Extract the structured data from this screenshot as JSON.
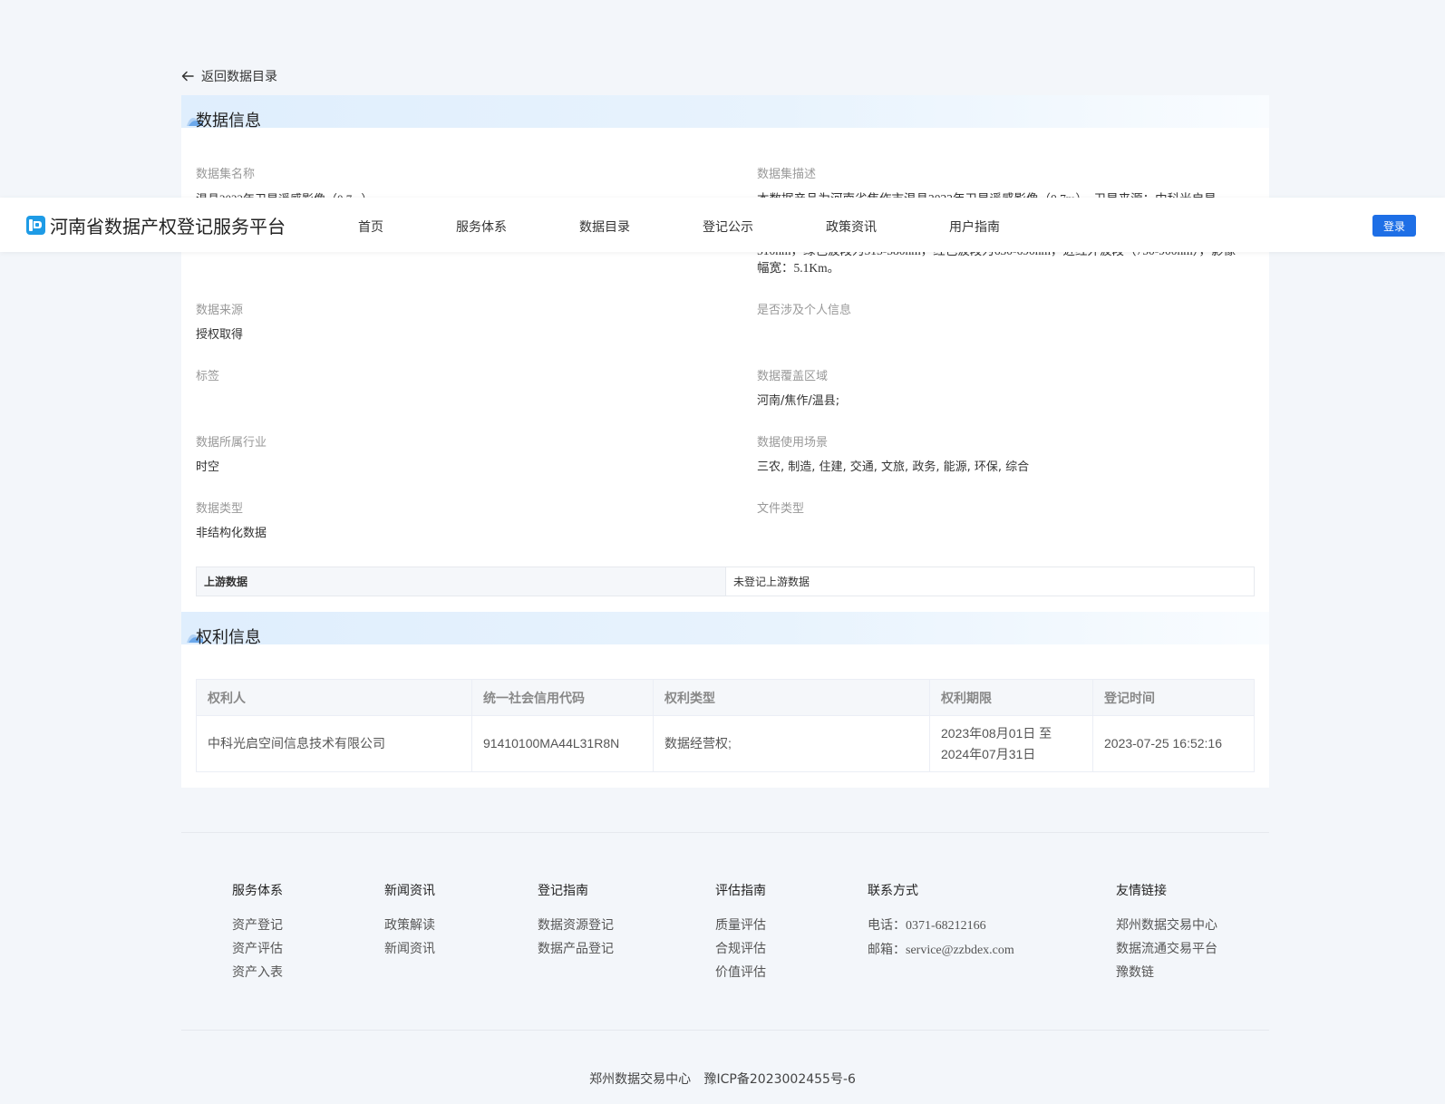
{
  "back": {
    "label": "返回数据目录"
  },
  "header": {
    "brand": "河南省数据产权登记服务平台",
    "nav": [
      "首页",
      "服务体系",
      "数据目录",
      "登记公示",
      "政策资讯",
      "用户指南"
    ],
    "login": "登录",
    "accent": "#1e6fe6"
  },
  "data_info": {
    "title": "数据信息",
    "name_label": "数据集名称",
    "name_value": "温县2022年卫星遥感影像（0.7m）",
    "desc_label": "数据集描述",
    "desc_line1": "本数据产品为河南省焦作市温县2022年卫星遥感影像（0.7m），卫星来源：中科光启星",
    "desc_line3": "510nm，绿色波段为515-580nm，红色波段为630-690nm，近红外波段（750-900nm），影像",
    "desc_line4": "幅宽：5.1Km。",
    "source_label": "数据来源",
    "source_value": "授权取得",
    "personal_label": "是否涉及个人信息",
    "personal_value": "",
    "tags_label": "标签",
    "tags_value": "",
    "region_label": "数据覆盖区域",
    "region_value": "河南/焦作/温县;",
    "industry_label": "数据所属行业",
    "industry_value": "时空",
    "scene_label": "数据使用场景",
    "scene_value": "三农, 制造, 住建, 交通, 文旅, 政务, 能源, 环保, 综合",
    "type_label": "数据类型",
    "type_value": "非结构化数据",
    "file_label": "文件类型",
    "file_value": "",
    "upstream_label": "上游数据",
    "upstream_value": "未登记上游数据"
  },
  "rights": {
    "title": "权利信息",
    "columns": [
      "权利人",
      "统一社会信用代码",
      "权利类型",
      "权利期限",
      "登记时间"
    ],
    "rows": [
      {
        "holder": "中科光启空间信息技术有限公司",
        "code": "91410100MA44L31R8N",
        "type": "数据经营权;",
        "term_start": "2023年08月01日 至",
        "term_end": "2024年07月31日",
        "time": "2023-07-25 16:52:16"
      }
    ]
  },
  "footer": {
    "cols": [
      {
        "head": "服务体系",
        "items": [
          "资产登记",
          "资产评估",
          "资产入表"
        ]
      },
      {
        "head": "新闻资讯",
        "items": [
          "政策解读",
          "新闻资讯"
        ]
      },
      {
        "head": "登记指南",
        "items": [
          "数据资源登记",
          "数据产品登记"
        ]
      },
      {
        "head": "评估指南",
        "items": [
          "质量评估",
          "合规评估",
          "价值评估"
        ]
      },
      {
        "head": "联系方式",
        "items": [
          "电话：",
          "邮箱："
        ],
        "values": [
          "0371-68212166",
          "service@zzbdex.com"
        ]
      },
      {
        "head": "友情链接",
        "items": [
          "郑州数据交易中心",
          "数据流通交易平台",
          "豫数链"
        ]
      }
    ],
    "copyright_org": "郑州数据交易中心",
    "icp": "豫ICP备2023002455号-6"
  }
}
